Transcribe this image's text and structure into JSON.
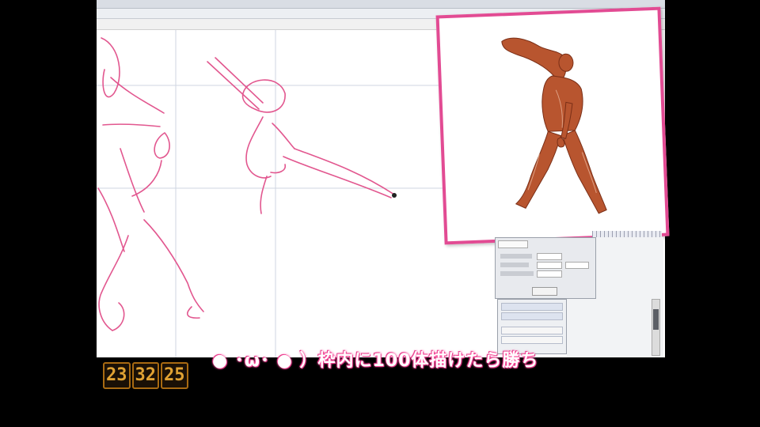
{
  "app": {
    "titlebar_text": "",
    "toolbar_text": "",
    "menubar_text": ""
  },
  "overlay": {
    "timer_hours": "23",
    "timer_minutes": "32",
    "timer_seconds": "25",
    "caption": "● ･ω･ ● ）枠内に100体描けたら勝ち"
  },
  "reference_panel": {
    "border_color": "#e24b93",
    "image_subject": "anatomy-muscle-figure"
  },
  "tool_panel": {
    "tab_label": "",
    "button_label": ""
  },
  "colors": {
    "sketch_stroke": "#e2578f",
    "guide_line": "#cfd6e2",
    "caption_glow": "#ff4fa0",
    "timer_text": "#e0a233"
  }
}
